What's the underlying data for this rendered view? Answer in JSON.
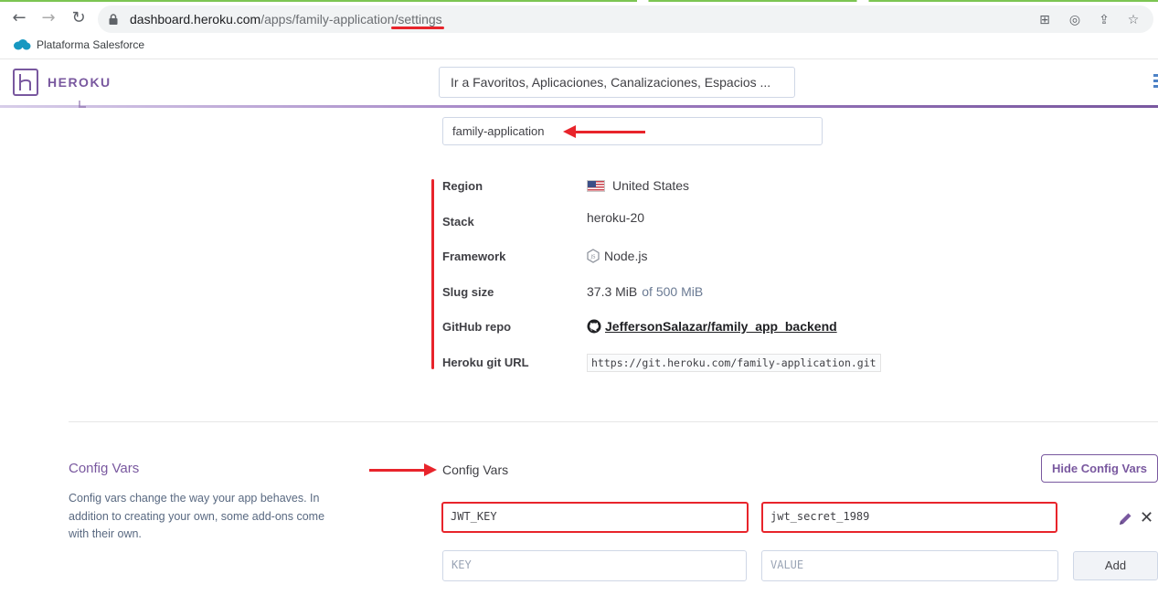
{
  "browser": {
    "url_host": "dashboard.heroku.com",
    "url_path_prefix": "/apps/family-application/",
    "url_path_last": "settings",
    "bookmark_label": "Plataforma Salesforce"
  },
  "header": {
    "brand": "HEROKU",
    "search_placeholder": "Ir a Favoritos, Aplicaciones, Canalizaciones, Espacios ..."
  },
  "app": {
    "name_value": "family-application",
    "info": [
      {
        "label": "Region",
        "value": "United States"
      },
      {
        "label": "Stack",
        "value": "heroku-20"
      },
      {
        "label": "Framework",
        "value": "Node.js"
      },
      {
        "label": "Slug size",
        "value": "37.3 MiB",
        "suffix": "of 500 MiB"
      },
      {
        "label": "GitHub repo",
        "value": "JeffersonSalazar/family_app_backend"
      },
      {
        "label": "Heroku git URL",
        "value": "https://git.heroku.com/family-application.git"
      }
    ]
  },
  "config_vars": {
    "section_title": "Config Vars",
    "description": "Config vars change the way your app behaves. In addition to creating your own, some add-ons come with their own.",
    "title": "Config Vars",
    "hide_button": "Hide Config Vars",
    "vars": [
      {
        "key": "JWT_KEY",
        "value": "jwt_secret_1989"
      }
    ],
    "new_key_placeholder": "KEY",
    "new_value_placeholder": "VALUE",
    "add_button": "Add"
  },
  "colors": {
    "brand_purple": "#79589f",
    "annotation_red": "#e8242b"
  }
}
